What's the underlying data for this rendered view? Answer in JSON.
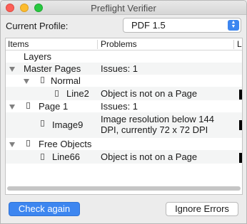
{
  "window": {
    "title": "Preflight Verifier"
  },
  "profile": {
    "label": "Current Profile:",
    "value": "PDF 1.5"
  },
  "table": {
    "columns": {
      "items": "Items",
      "problems": "Problems",
      "extra": "La"
    },
    "rows": [
      {
        "item": "Layers",
        "problem": ""
      },
      {
        "item": "Master Pages",
        "problem": "Issues: 1"
      },
      {
        "item": "Normal",
        "problem": ""
      },
      {
        "item": "Line2",
        "problem": "Object is not on a Page"
      },
      {
        "item": "Page 1",
        "problem": "Issues: 1"
      },
      {
        "item": "Image9",
        "problem": "Image resolution below 144 DPI, currently 72 x 72 DPI"
      },
      {
        "item": "Free Objects",
        "problem": ""
      },
      {
        "item": "Line66",
        "problem": "Object is not on a Page"
      }
    ]
  },
  "buttons": {
    "check_again": "Check again",
    "ignore_errors": "Ignore Errors"
  }
}
